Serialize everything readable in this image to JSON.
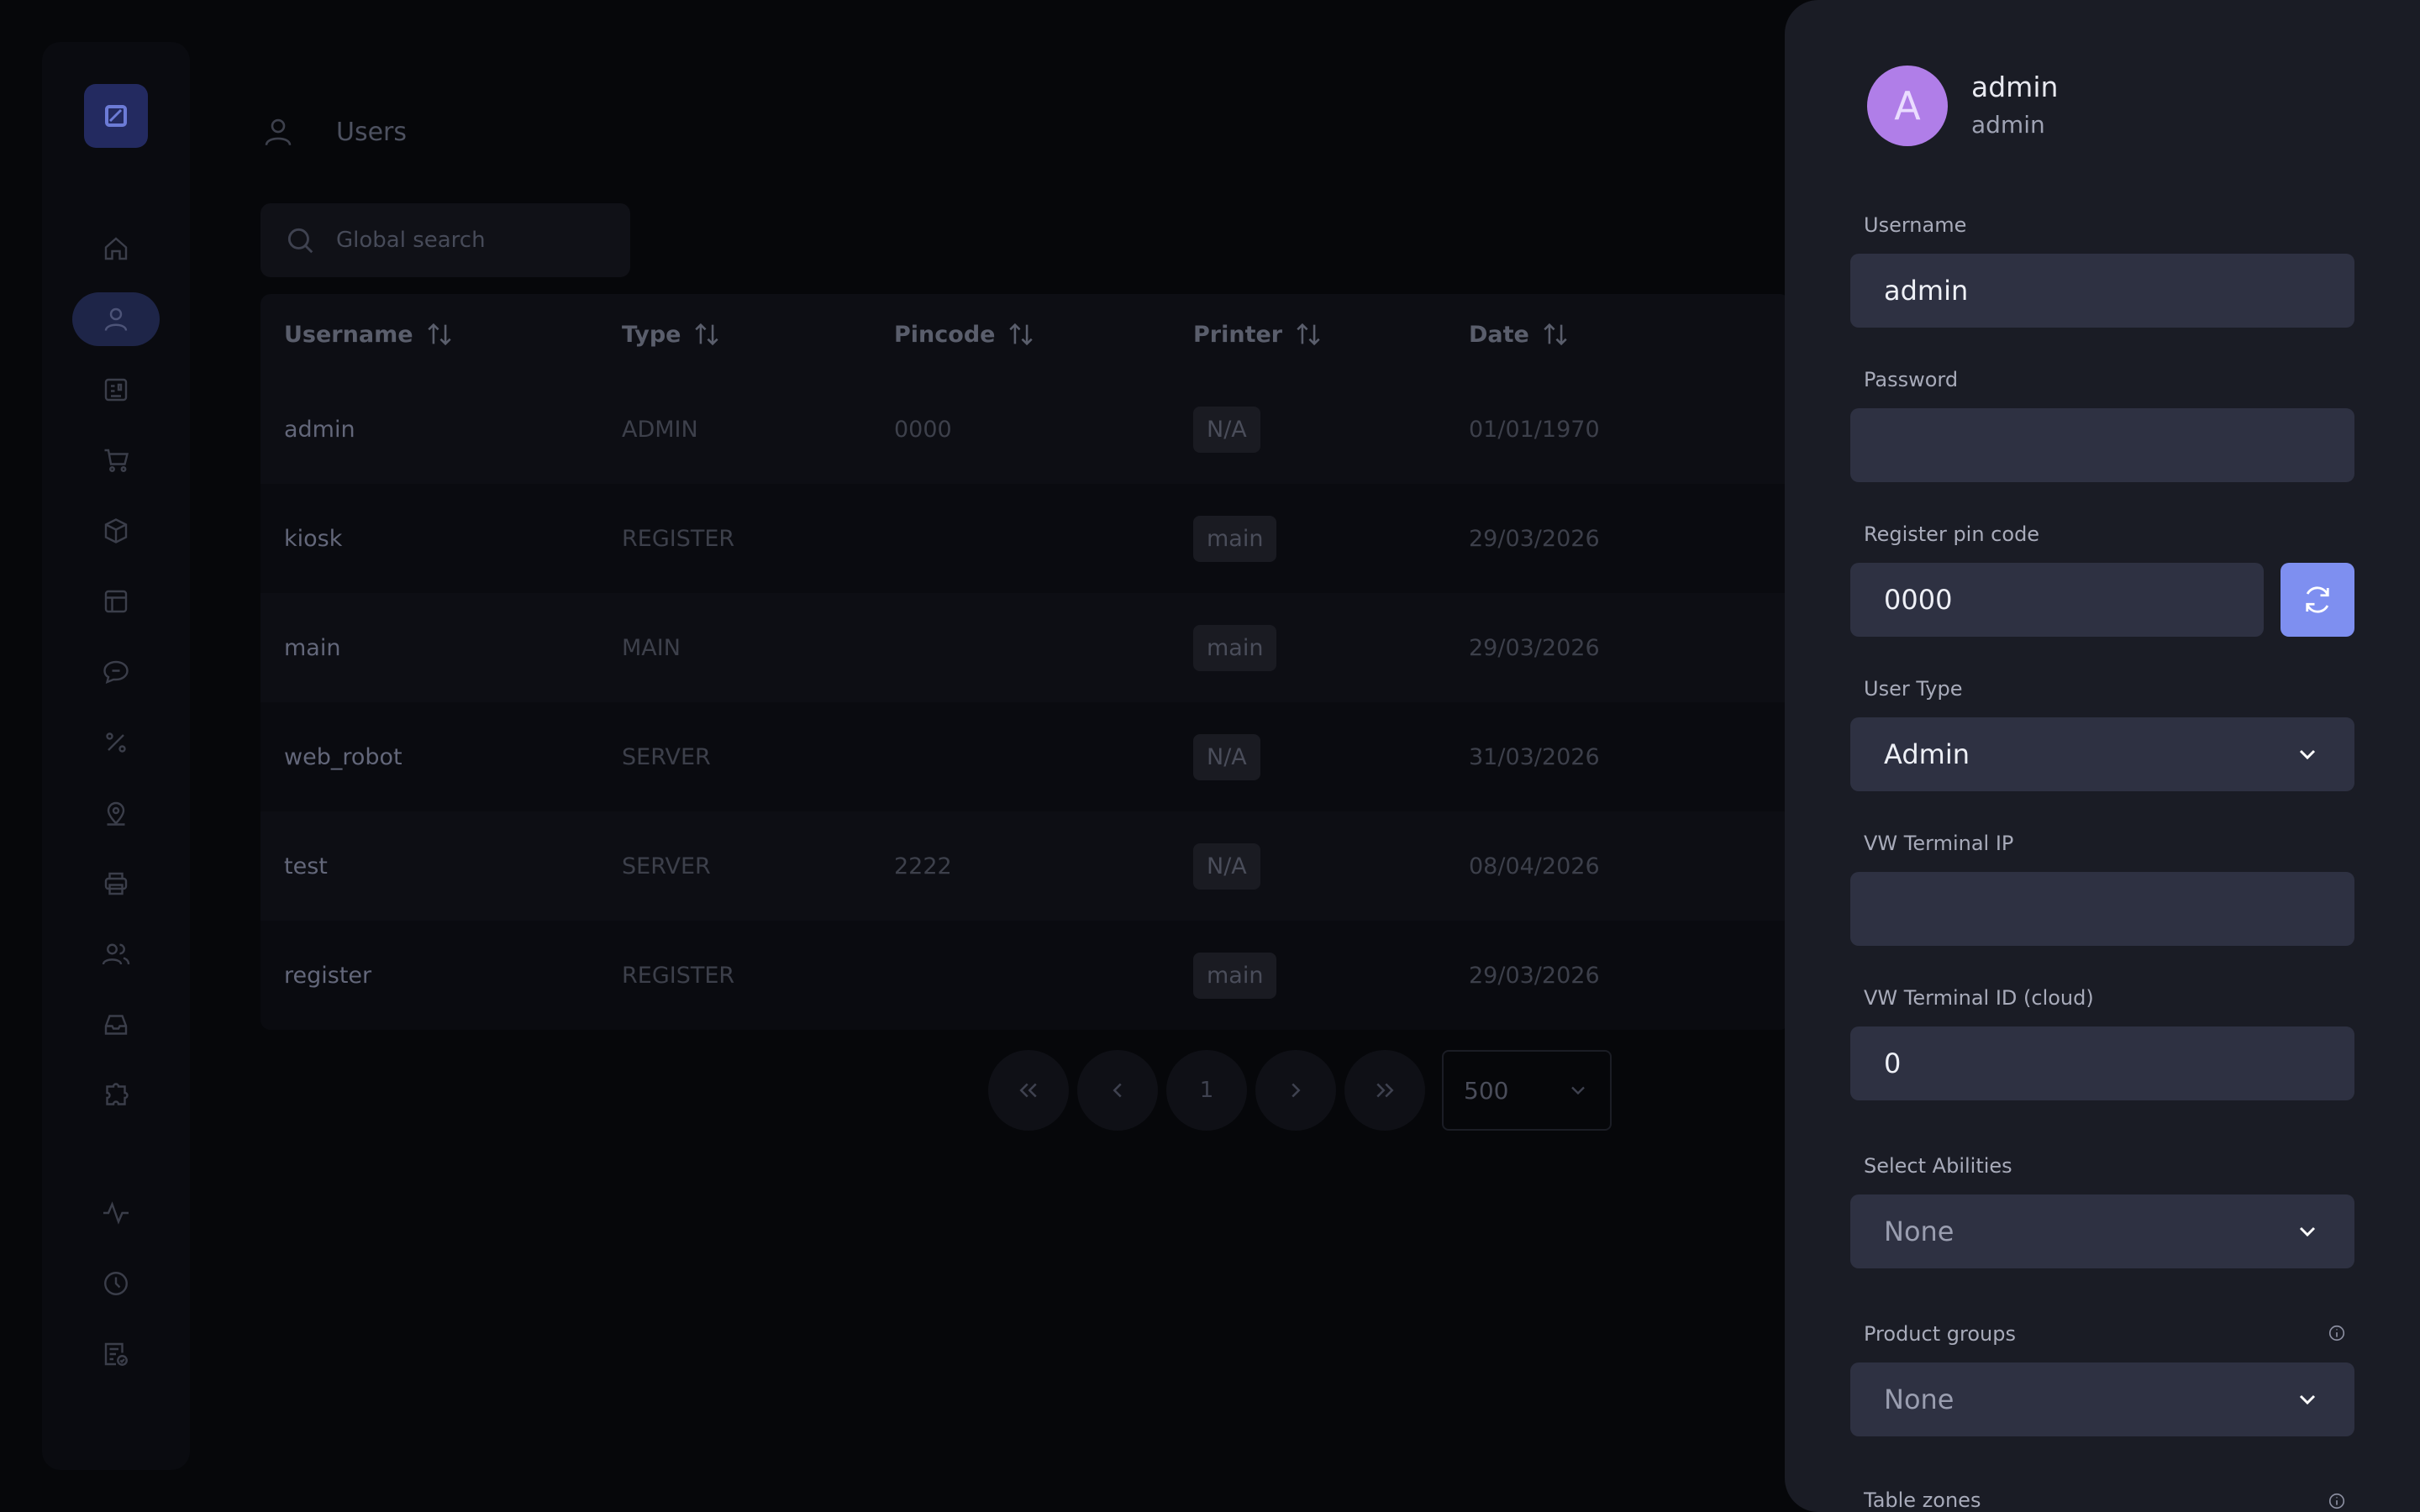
{
  "page": {
    "title": "Users"
  },
  "search": {
    "placeholder": "Global search"
  },
  "sidebar": {
    "items": [
      {
        "icon": "home-icon"
      },
      {
        "icon": "user-icon",
        "active": true
      },
      {
        "icon": "list-icon"
      },
      {
        "icon": "cart-icon"
      },
      {
        "icon": "box-icon"
      },
      {
        "icon": "table-icon"
      },
      {
        "icon": "message-icon"
      },
      {
        "icon": "percent-icon"
      },
      {
        "icon": "map-pin-icon"
      },
      {
        "icon": "printer-icon"
      },
      {
        "icon": "users-icon"
      },
      {
        "icon": "inbox-icon"
      },
      {
        "icon": "puzzle-icon"
      },
      {
        "icon": "activity-icon"
      },
      {
        "icon": "clock-icon"
      },
      {
        "icon": "checklist-icon"
      }
    ]
  },
  "table": {
    "columns": [
      "Username",
      "Type",
      "Pincode",
      "Printer",
      "Date"
    ],
    "rows": [
      [
        "admin",
        "ADMIN",
        "0000",
        "N/A",
        "01/01/1970"
      ],
      [
        "kiosk",
        "REGISTER",
        "",
        "main",
        "29/03/2026"
      ],
      [
        "main",
        "MAIN",
        "",
        "main",
        "29/03/2026"
      ],
      [
        "web_robot",
        "SERVER",
        "",
        "N/A",
        "31/03/2026"
      ],
      [
        "test",
        "SERVER",
        "2222",
        "N/A",
        "08/04/2026"
      ],
      [
        "register",
        "REGISTER",
        "",
        "main",
        "29/03/2026"
      ]
    ]
  },
  "pagination": {
    "first": "«",
    "prev": "‹",
    "current": "1",
    "next": "›",
    "last": "»",
    "page_size": "500"
  },
  "drawer": {
    "avatar_letter": "A",
    "name": "admin",
    "role": "admin",
    "fields": {
      "username_label": "Username",
      "username_value": "admin",
      "password_label": "Password",
      "password_value": "",
      "pin_label": "Register pin code",
      "pin_value": "0000",
      "user_type_label": "User Type",
      "user_type_value": "Admin",
      "vw_ip_label": "VW Terminal IP",
      "vw_ip_value": "",
      "vw_id_label": "VW Terminal ID (cloud)",
      "vw_id_value": "0",
      "abilities_label": "Select Abilities",
      "abilities_value": "None",
      "product_groups_label": "Product groups",
      "product_groups_value": "None",
      "table_zones_label": "Table zones"
    }
  },
  "colors": {
    "background": "#06070a",
    "drawer": "#1a1c25",
    "field": "#2e3142",
    "accent": "#7e8ff0",
    "avatar": "#b07ee8"
  }
}
